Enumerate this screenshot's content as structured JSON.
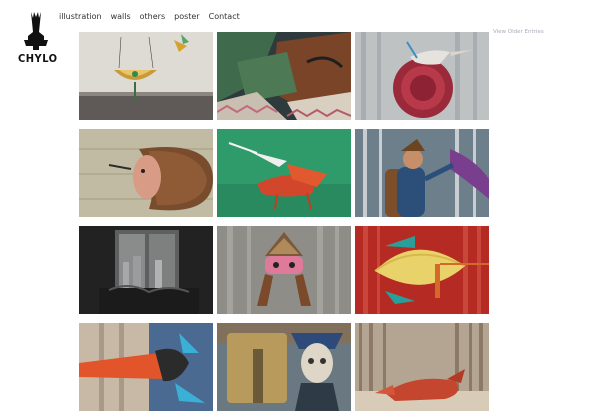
{
  "site": {
    "logo_text": "CHYLO",
    "logo_icon": "chess-rook-figure-icon"
  },
  "nav": {
    "items": [
      {
        "label": "illustration"
      },
      {
        "label": "walls"
      },
      {
        "label": "others"
      },
      {
        "label": "poster"
      },
      {
        "label": "Contact"
      }
    ]
  },
  "pagination": {
    "older_label": "View Older Entries"
  },
  "gallery": {
    "tiles": [
      {
        "subject": "bowl-creature-on-wall",
        "bg": "#d9d6d0"
      },
      {
        "subject": "geometric-wall-mural",
        "bg": "#2f3a3c"
      },
      {
        "subject": "red-hair-bird-bun",
        "bg": "#b9bdc0"
      },
      {
        "subject": "hair-face-creature",
        "bg": "#b8b39a"
      },
      {
        "subject": "red-fox-on-green",
        "bg": "#2f9c6c"
      },
      {
        "subject": "hiker-in-forest",
        "bg": "#5b6a7a"
      },
      {
        "subject": "dark-window-interior",
        "bg": "#2a2a2a"
      },
      {
        "subject": "masked-figure-in-woods",
        "bg": "#8f8d87"
      },
      {
        "subject": "yellow-fish-in-red-forest",
        "bg": "#b52b24"
      },
      {
        "subject": "orange-beak-bird-collage",
        "bg": "#5e7aa0"
      },
      {
        "subject": "skull-hat-figure",
        "bg": "#6d7c86"
      },
      {
        "subject": "red-fox-resting",
        "bg": "#a99a88"
      }
    ]
  }
}
